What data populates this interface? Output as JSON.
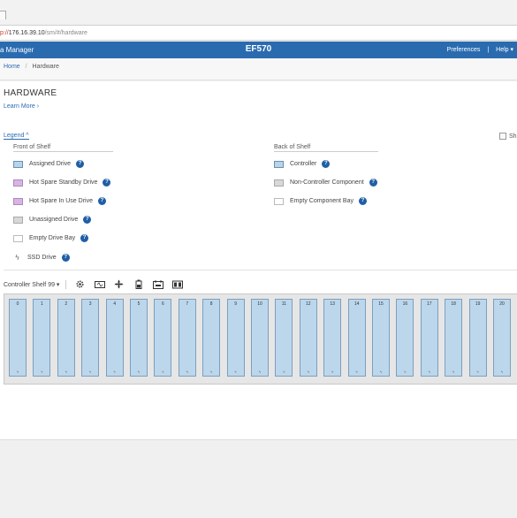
{
  "browser": {
    "url_scheme": "p://",
    "url_host": "176.16.39.10",
    "url_path": "/sm/#/hardware"
  },
  "header": {
    "app_name": "a Manager",
    "model": "EF570",
    "preferences": "Preferences",
    "separator": "|",
    "help": "Help ▾"
  },
  "breadcrumb": {
    "home": "Home",
    "sep": "/",
    "current": "Hardware"
  },
  "page": {
    "title": "HARDWARE",
    "learn_more": "Learn More ›",
    "legend_toggle": "Legend ^",
    "show_label": "Sh"
  },
  "legend": {
    "front_heading": "Front of Shelf",
    "back_heading": "Back of Shelf",
    "front_items": [
      {
        "label": "Assigned Drive",
        "swatch": "assigned",
        "color": "#b7d4ea"
      },
      {
        "label": "Hot Spare Standby Drive",
        "swatch": "hs",
        "color": "#d9b3e6"
      },
      {
        "label": "Hot Spare In Use Drive",
        "swatch": "hsu",
        "color": "#d9b3e6"
      },
      {
        "label": "Unassigned Drive",
        "swatch": "unassigned",
        "color": "#d8d8d8"
      },
      {
        "label": "Empty Drive Bay",
        "swatch": "empty",
        "color": "#ffffff"
      },
      {
        "label": "SSD Drive",
        "swatch": "ssd",
        "icon": "bolt-icon"
      }
    ],
    "back_items": [
      {
        "label": "Controller",
        "swatch": "controller",
        "color": "#b7d4ea"
      },
      {
        "label": "Non-Controller Component",
        "swatch": "noncontroller",
        "color": "#d8d8d8"
      },
      {
        "label": "Empty Component Bay",
        "swatch": "empty",
        "color": "#ffffff"
      }
    ],
    "help_glyph": "?"
  },
  "shelf": {
    "name": "Controller Shelf 99 ▾",
    "toolbar_icons": [
      "gear-icon",
      "power-supply-icon",
      "fan-icon",
      "battery-icon",
      "temperature-sensor-icon",
      "controller-icon"
    ],
    "bays": [
      "0",
      "1",
      "2",
      "3",
      "4",
      "5",
      "6",
      "7",
      "8",
      "9",
      "10",
      "11",
      "12",
      "13",
      "14",
      "15",
      "16",
      "17",
      "18",
      "19",
      "20"
    ],
    "bay_indicator": "ϟ"
  },
  "colors": {
    "header_blue": "#2a6bb0",
    "link_blue": "#2a6bb0",
    "help_blue": "#1f5fa6",
    "drive_blue": "#bcd7ec"
  }
}
